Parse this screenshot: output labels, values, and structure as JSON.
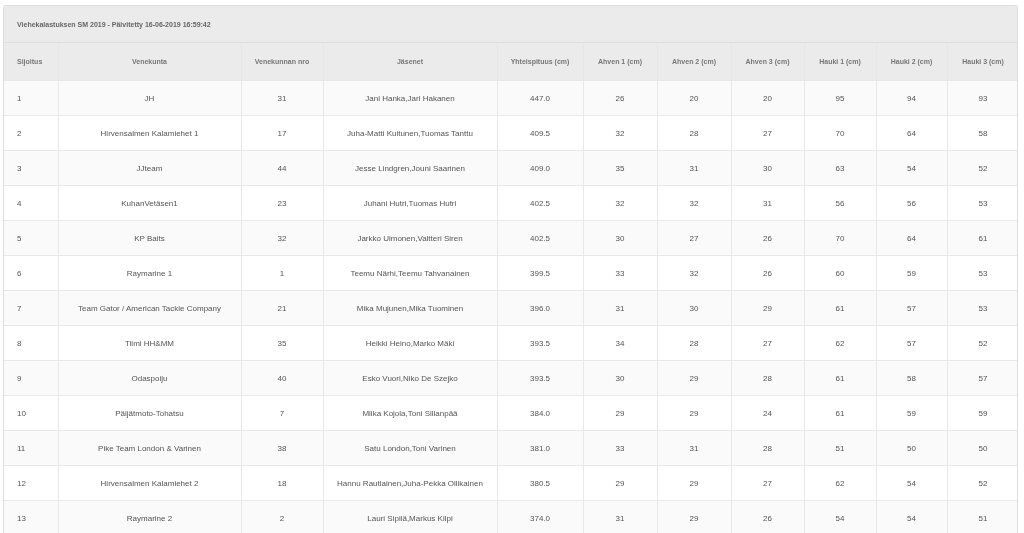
{
  "panel": {
    "heading": "Viehekalastuksen SM 2019 - Päivitetty 16-06-2019 16:59:42"
  },
  "table": {
    "columns": [
      "Sijoitus",
      "Venekunta",
      "Venekunnan nro",
      "Jäsenet",
      "Yhteispituus (cm)",
      "Ahven 1 (cm)",
      "Ahven 2 (cm)",
      "Ahven 3 (cm)",
      "Hauki 1 (cm)",
      "Hauki 2 (cm)",
      "Hauki 3 (cm)"
    ],
    "rows": [
      [
        "1",
        "JH",
        "31",
        "Jani Hanka,Jari Hakanen",
        "447.0",
        "26",
        "20",
        "20",
        "95",
        "94",
        "93"
      ],
      [
        "2",
        "Hirvensalmen Kalamiehet 1",
        "17",
        "Juha-Matti Kuitunen,Tuomas Tanttu",
        "409.5",
        "32",
        "28",
        "27",
        "70",
        "64",
        "58"
      ],
      [
        "3",
        "JJteam",
        "44",
        "Jesse Lindgren,Jouni Saarinen",
        "409.0",
        "35",
        "31",
        "30",
        "63",
        "54",
        "52"
      ],
      [
        "4",
        "KuhanVetäsen1",
        "23",
        "Juhani Hutri,Tuomas Hutri",
        "402.5",
        "32",
        "32",
        "31",
        "56",
        "56",
        "53"
      ],
      [
        "5",
        "KP Baits",
        "32",
        "Jarkko Uimonen,Valtteri Siren",
        "402.5",
        "30",
        "27",
        "26",
        "70",
        "64",
        "61"
      ],
      [
        "6",
        "Raymarine 1",
        "1",
        "Teemu Närhi,Teemu Tahvanainen",
        "399.5",
        "33",
        "32",
        "26",
        "60",
        "59",
        "53"
      ],
      [
        "7",
        "Team Gator / American Tackle Company",
        "21",
        "Mika Mujunen,Mika Tuominen",
        "396.0",
        "31",
        "30",
        "29",
        "61",
        "57",
        "53"
      ],
      [
        "8",
        "Tiimi HH&MM",
        "35",
        "Heikki Heino,Marko Mäki",
        "393.5",
        "34",
        "28",
        "27",
        "62",
        "57",
        "52"
      ],
      [
        "9",
        "Odaspoiju",
        "40",
        "Esko Vuori,Niko De Szejko",
        "393.5",
        "30",
        "29",
        "28",
        "61",
        "58",
        "57"
      ],
      [
        "10",
        "Päijätmoto-Tohatsu",
        "7",
        "Miika Kojola,Toni Sillanpää",
        "384.0",
        "29",
        "29",
        "24",
        "61",
        "59",
        "59"
      ],
      [
        "11",
        "Pike Team London & Varinen",
        "38",
        "Satu London,Toni Varinen",
        "381.0",
        "33",
        "31",
        "28",
        "51",
        "50",
        "50"
      ],
      [
        "12",
        "Hirvensalmen Kalamiehet 2",
        "18",
        "Hannu Rautiainen,Juha-Pekka Ollikainen",
        "380.5",
        "29",
        "29",
        "27",
        "62",
        "54",
        "52"
      ],
      [
        "13",
        "Raymarine 2",
        "2",
        "Lauri Sipilä,Markus Kilpi",
        "374.0",
        "31",
        "29",
        "26",
        "54",
        "54",
        "51"
      ]
    ]
  }
}
